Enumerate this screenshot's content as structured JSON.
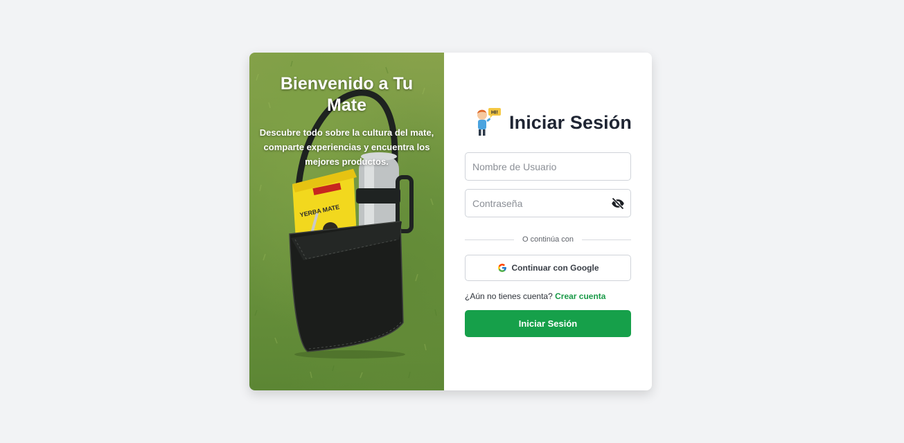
{
  "hero": {
    "title": "Bienvenido a Tu Mate",
    "subtitle": "Descubre todo sobre la cultura del mate, comparte experiencias y encuentra los mejores productos.",
    "image_label": "YERBA MATE"
  },
  "form": {
    "title": "Iniciar Sesión",
    "avatar_bubble": "HI!",
    "username": {
      "placeholder": "Nombre de Usuario",
      "value": ""
    },
    "password": {
      "placeholder": "Contraseña",
      "value": ""
    },
    "divider_text": "O continúa con",
    "google_button": "Continuar con Google",
    "signup_prompt": "¿Aún no tienes cuenta?",
    "signup_link": "Crear cuenta",
    "submit_button": "Iniciar Sesión"
  },
  "icons": {
    "password_toggle": "eye-off-icon",
    "google": "google-icon",
    "avatar": "waving-person-icon"
  },
  "colors": {
    "page_background": "#f2f3f5",
    "primary_green": "#16a04a",
    "link_green": "#1a9a48",
    "title_color": "#1f2533"
  }
}
